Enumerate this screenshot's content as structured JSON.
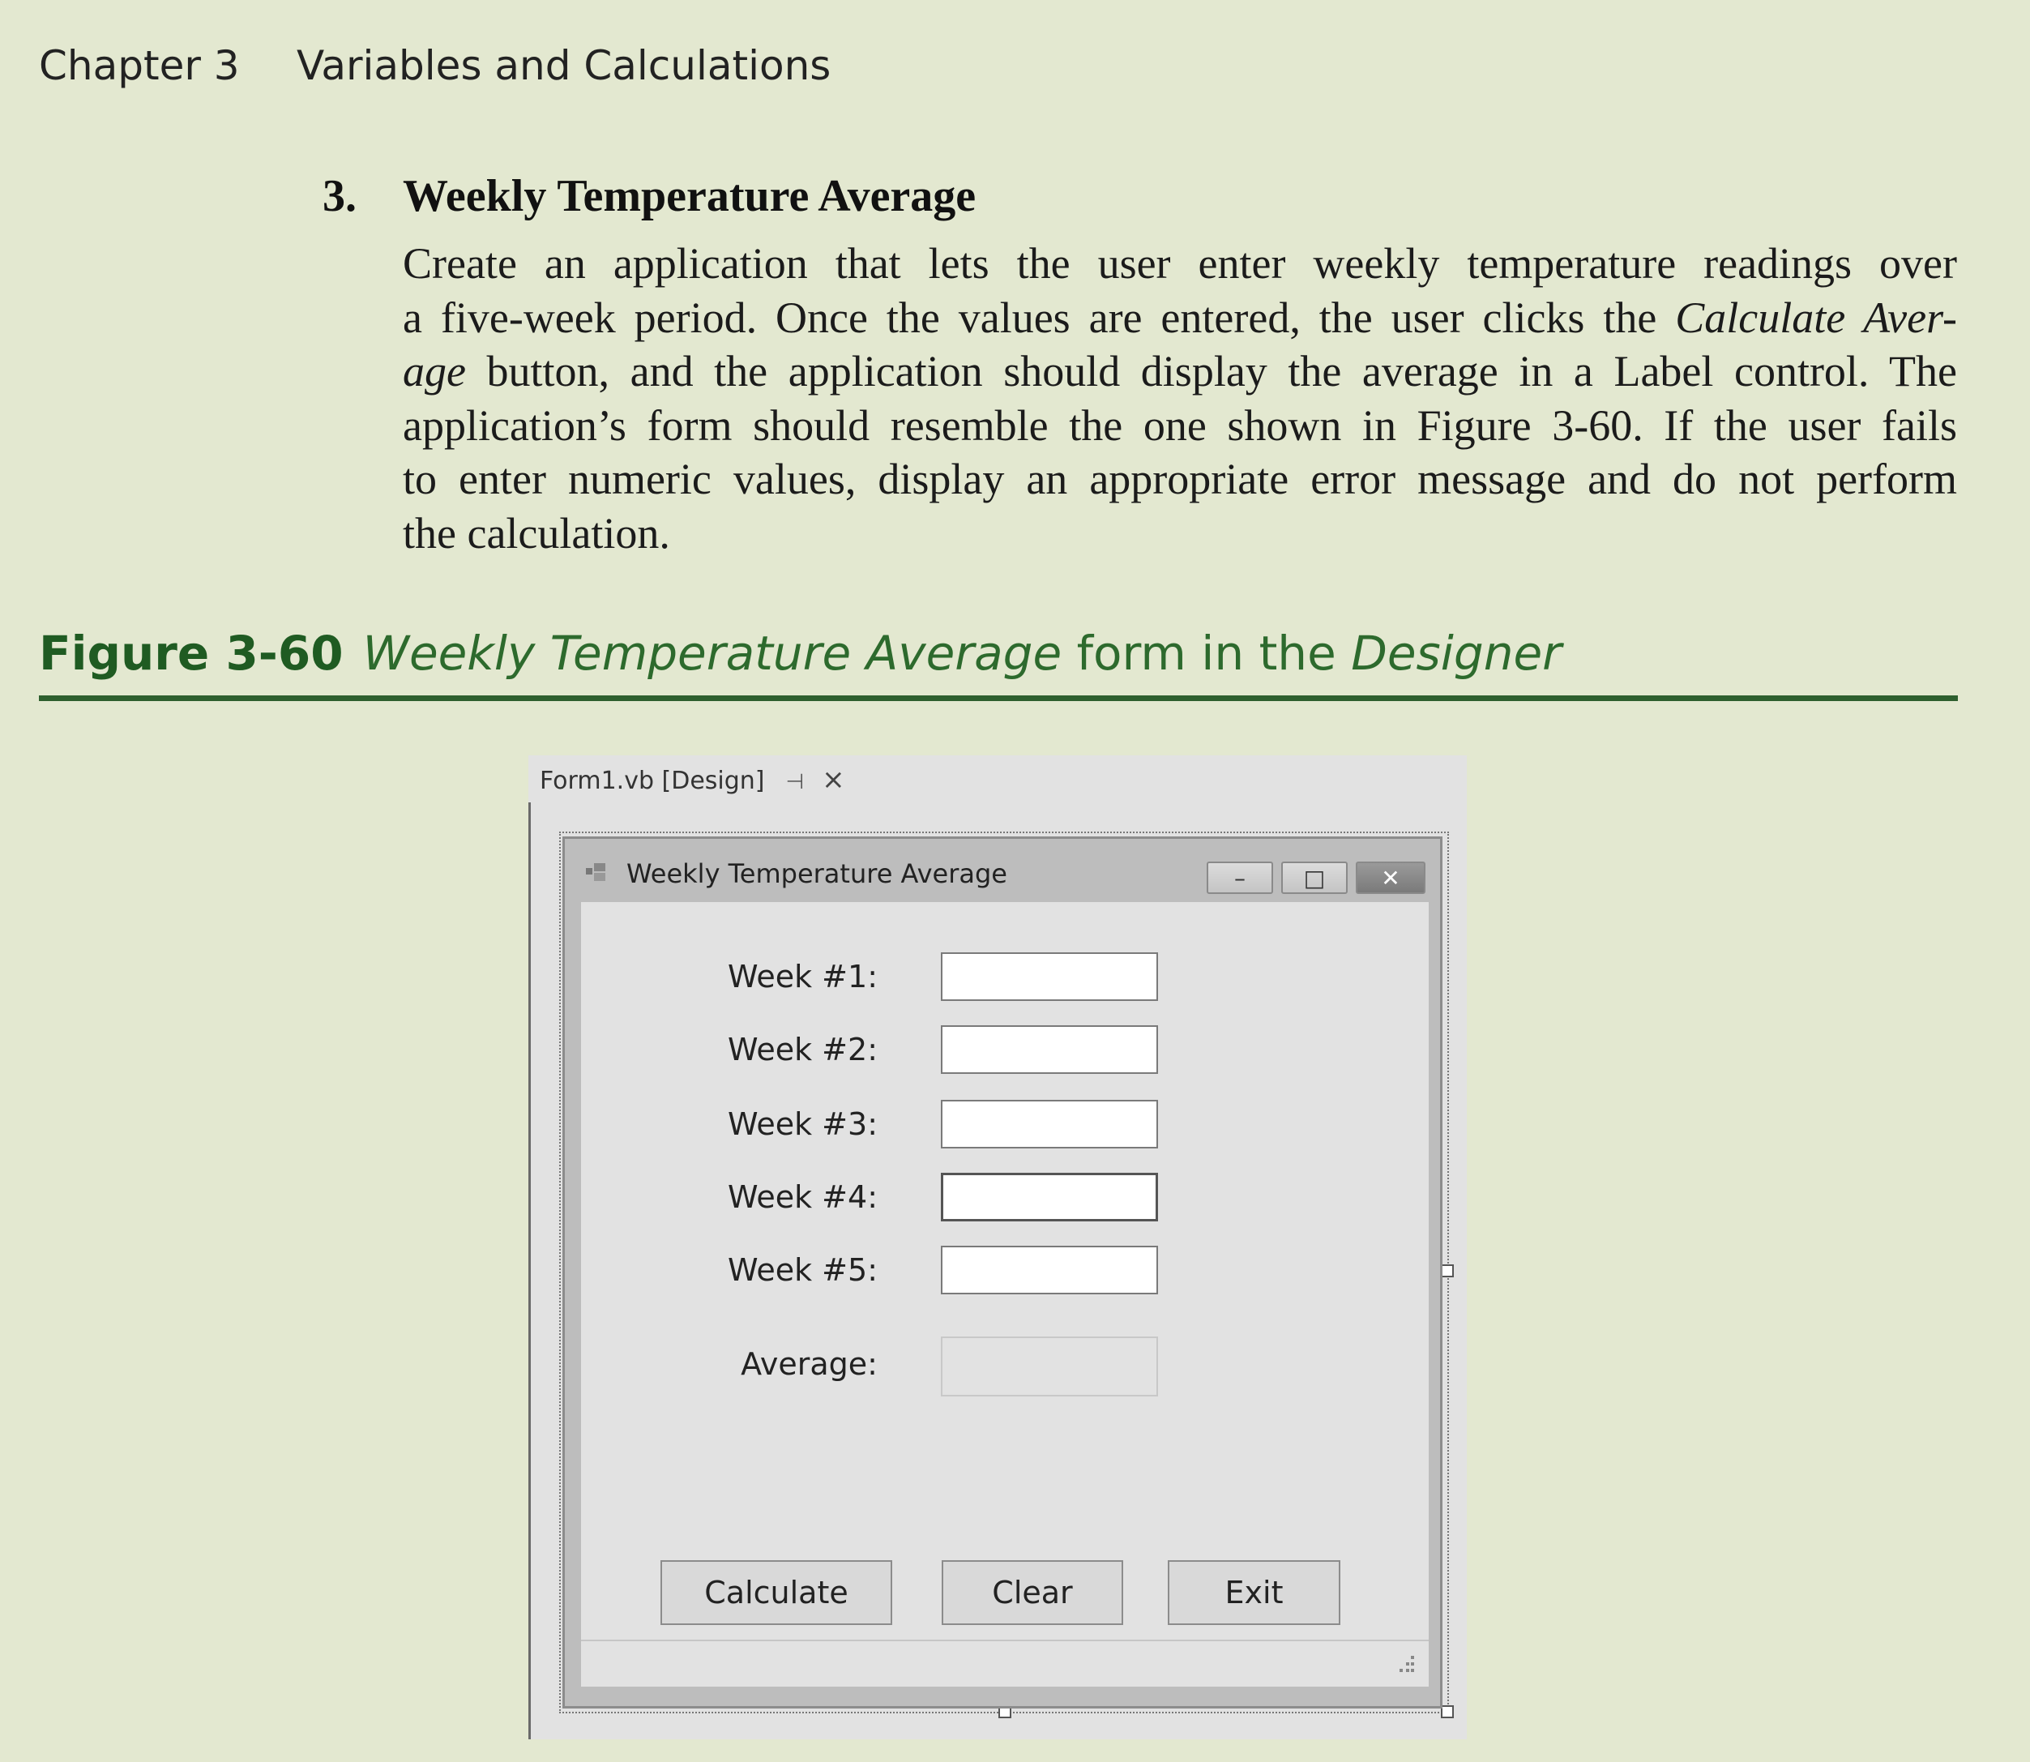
{
  "running_head": {
    "chapter": "Chapter 3",
    "title": "Variables and Calculations"
  },
  "exercise": {
    "number": "3.",
    "title": "Weekly Temperature Average",
    "lines": [
      "Create an application that lets the user enter weekly temperature readings over",
      "a five-week period. Once the values are entered, the user clicks the",
      "Calculate Aver-",
      "age",
      "button, and the application should display the average in a Label control. The",
      "application’s form should resemble the one shown in Figure 3-60. If the user fails",
      "to enter numeric values, display an appropriate error message and do not perform",
      "the calculation."
    ]
  },
  "figure": {
    "number": "Figure 3-60",
    "caption_italic_1": "Weekly Temperature Average",
    "caption_plain": "form in the",
    "caption_italic_2": "Designer"
  },
  "designer": {
    "tab_label": "Form1.vb [Design]",
    "pin_icon": "pin-icon",
    "close_icon": "close-icon",
    "form_title": "Weekly Temperature Average",
    "caption_buttons": {
      "minimize": "–",
      "maximize": "□",
      "close": "✕"
    },
    "fields": [
      {
        "label": "Week #1:"
      },
      {
        "label": "Week #2:"
      },
      {
        "label": "Week #3:"
      },
      {
        "label": "Week #4:"
      },
      {
        "label": "Week #5:"
      }
    ],
    "average_label": "Average:",
    "buttons": {
      "calculate": "Calculate",
      "clear": "Clear",
      "exit": "Exit"
    }
  },
  "colors": {
    "page_bg": "#e3e8d0",
    "caption_green": "#2d6a2d",
    "rule_green": "#2e5f2e"
  }
}
